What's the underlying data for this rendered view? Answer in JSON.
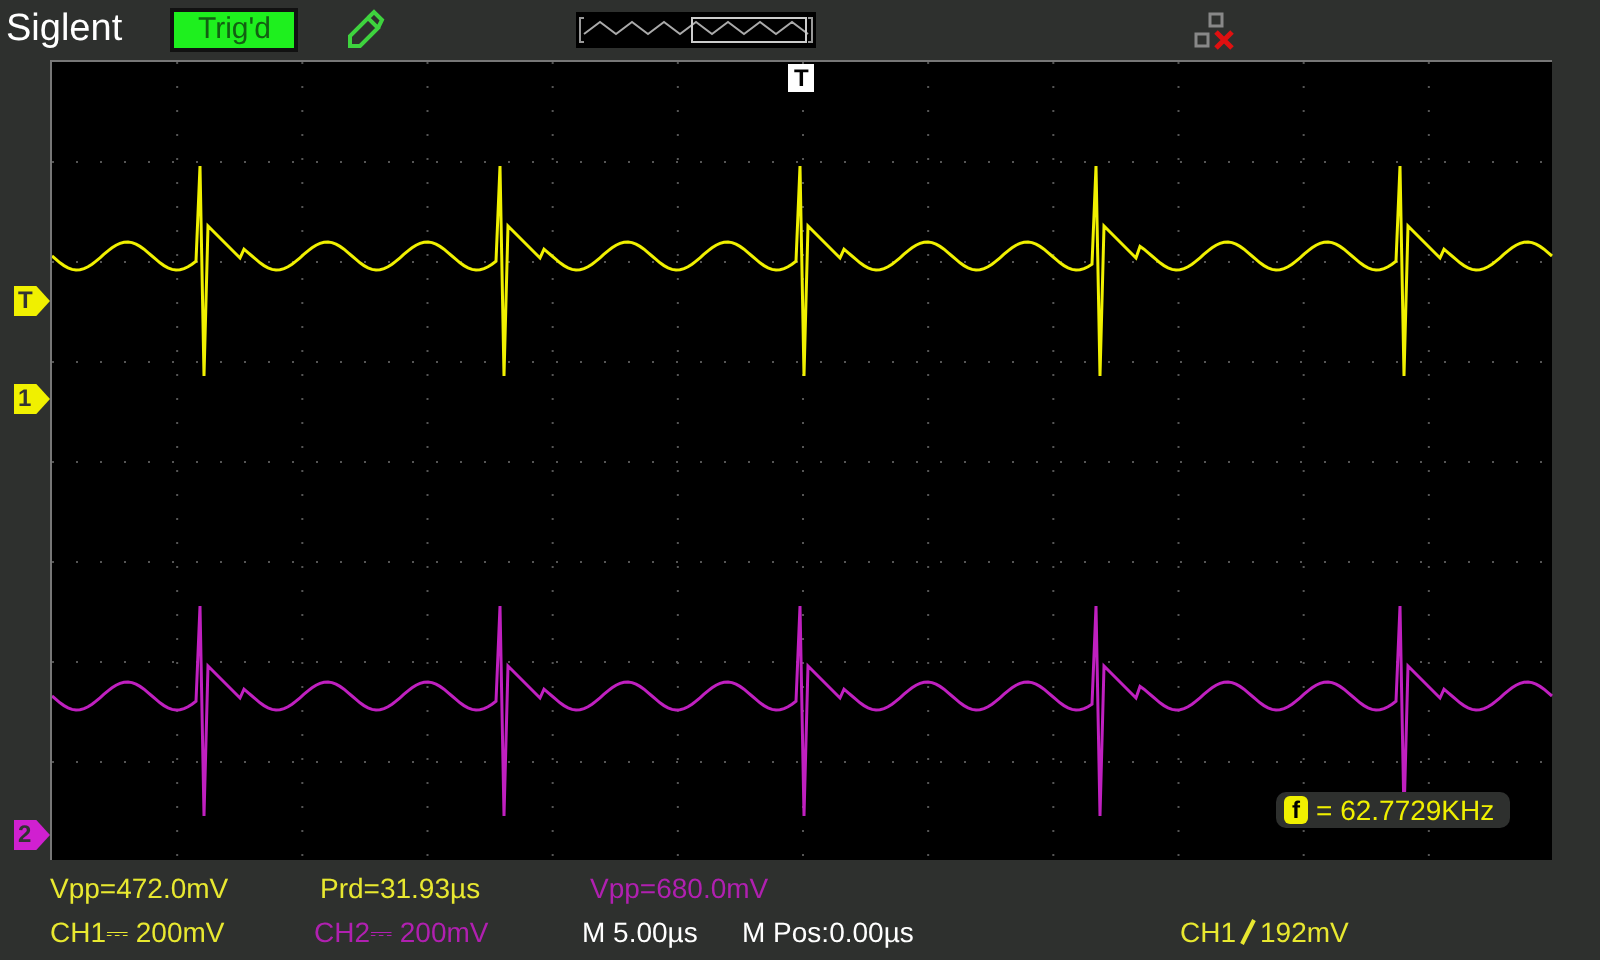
{
  "header": {
    "brand": "Siglent",
    "trigger_status": "Trig'd"
  },
  "display": {
    "trigger_position": "T",
    "markers": [
      {
        "label": "T",
        "kind": "trigger_level",
        "color": "#f0f000"
      },
      {
        "label": "1",
        "kind": "channel",
        "color": "#f0f000"
      },
      {
        "label": "2",
        "kind": "channel",
        "color": "#d020d0"
      }
    ],
    "frequency": {
      "badge": "f",
      "reading": "= 62.7729KHz"
    }
  },
  "measurements": [
    {
      "text": "Vpp=472.0mV",
      "color": "#e8e830"
    },
    {
      "text": "Prd=31.93µs",
      "color": "#e8e830"
    },
    {
      "text": "Vpp=680.0mV",
      "color": "#b020b0"
    }
  ],
  "status": [
    {
      "kind": "text",
      "text": "CH1⎓ 200mV",
      "color": "#e8e830"
    },
    {
      "kind": "text",
      "text": "CH2⎓ 200mV",
      "color": "#b020b0"
    },
    {
      "kind": "text",
      "text": "M 5.00µs",
      "color": "#ffffff"
    },
    {
      "kind": "text",
      "text": "M Pos:0.00µs",
      "color": "#ffffff"
    },
    {
      "kind": "trigger",
      "source": "CH1",
      "level": "192mV",
      "color": "#e8e830"
    }
  ]
}
